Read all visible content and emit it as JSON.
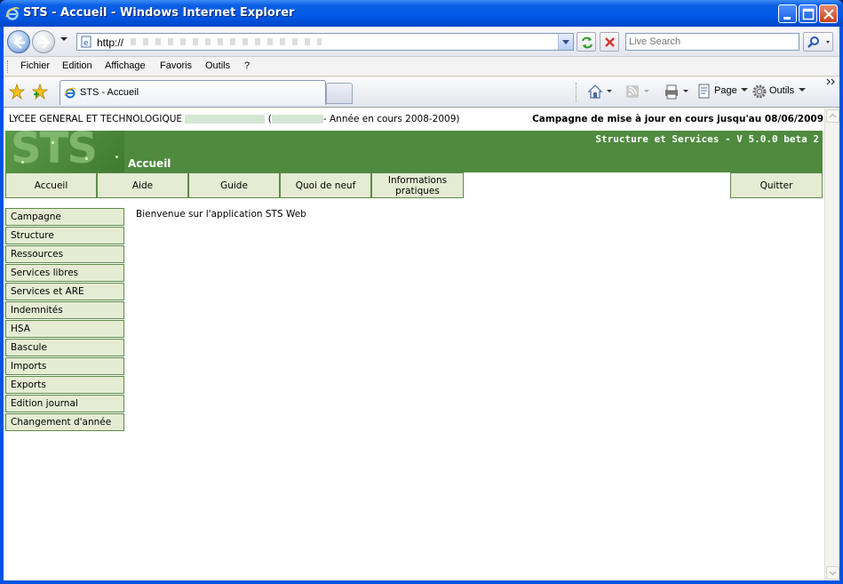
{
  "window": {
    "title": "STS - Accueil - Windows Internet Explorer"
  },
  "addressbar": {
    "url": "http://",
    "search_placeholder": "Live Search"
  },
  "menu": [
    "Fichier",
    "Edition",
    "Affichage",
    "Favoris",
    "Outils",
    "?"
  ],
  "browser_tab": {
    "label": "STS - Accueil"
  },
  "commandbar": {
    "page_label": "Page",
    "tools_label": "Outils"
  },
  "page": {
    "school_prefix": "LYCEE GENERAL ET TECHNOLOGIQUE",
    "year_text": "- Année en cours 2008-2009)",
    "campaign_notice": "Campagne de mise à jour en cours jusqu'au 08/06/2009",
    "app_version": "Structure et Services - V 5.0.0 beta 2",
    "logo_text": "STS",
    "current_page": "Accueil",
    "tabs": [
      "Accueil",
      "Aide",
      "Guide",
      "Quoi de neuf",
      "Informations pratiques"
    ],
    "quit_label": "Quitter",
    "side_menu": [
      "Campagne",
      "Structure",
      "Ressources",
      "Services libres",
      "Services et ARE",
      "Indemnités",
      "HSA",
      "Bascule",
      "Imports",
      "Exports",
      "Edition journal",
      "Changement d'année"
    ],
    "welcome_text": "Bienvenue sur l'application STS Web"
  },
  "colors": {
    "header_green": "#4f8a3f",
    "menu_bg": "#e6ecd3",
    "menu_border": "#5c8a4a"
  }
}
